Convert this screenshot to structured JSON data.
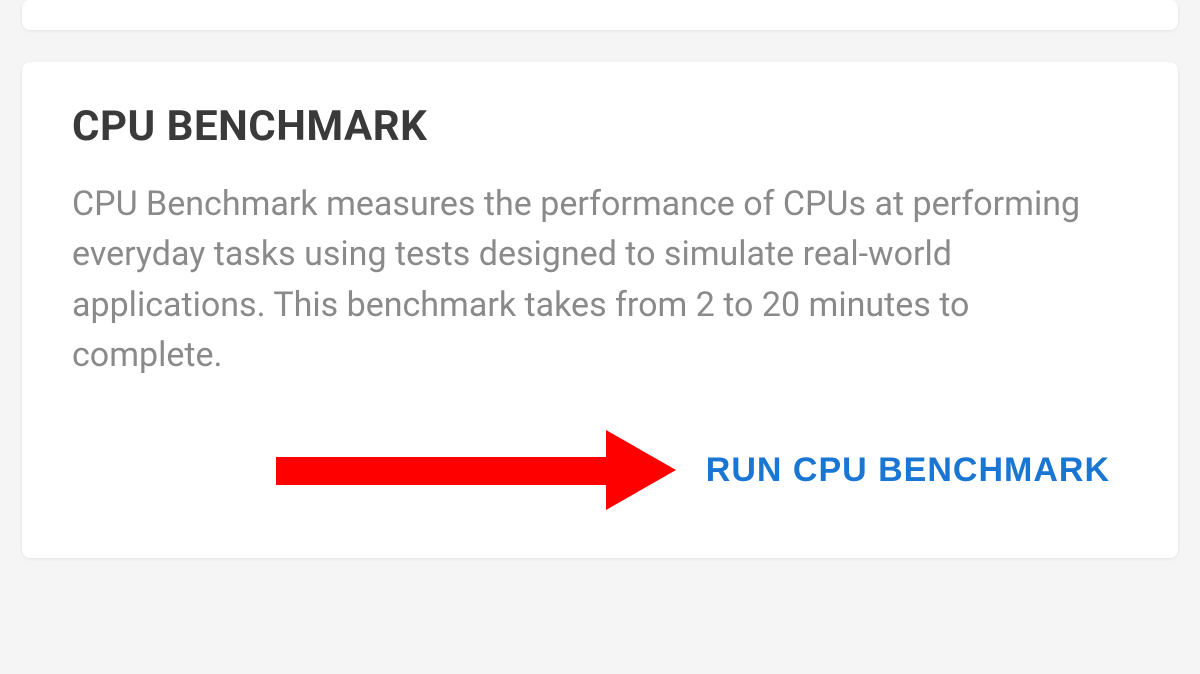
{
  "card": {
    "title": "CPU BENCHMARK",
    "description": "CPU Benchmark measures the performance of CPUs at performing everyday tasks using tests designed to simulate real-world applications. This benchmark takes from 2 to 20 minutes to complete.",
    "run_button_label": "RUN CPU BENCHMARK"
  },
  "colors": {
    "accent": "#1976d2",
    "annotation": "#ff0000"
  }
}
